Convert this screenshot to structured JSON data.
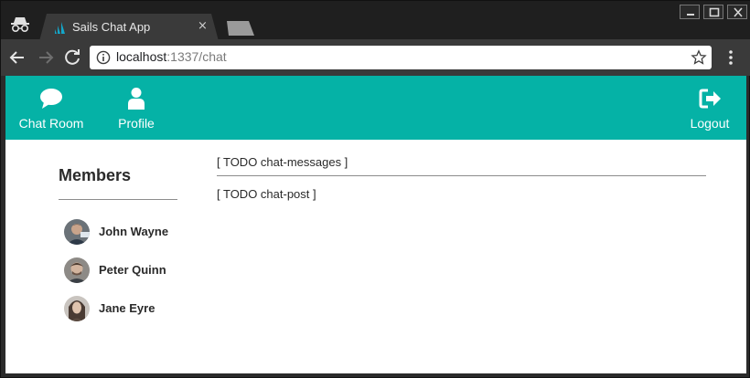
{
  "browser": {
    "tab": {
      "title": "Sails Chat App",
      "close": "×"
    },
    "address": {
      "host": "localhost",
      "path": ":1337/chat"
    }
  },
  "navbar": {
    "color": "#05b2a6",
    "items": [
      {
        "label": "Chat Room",
        "icon": "comment-icon"
      },
      {
        "label": "Profile",
        "icon": "user-icon"
      }
    ],
    "logout": {
      "label": "Logout",
      "icon": "sign-out-icon"
    }
  },
  "members": {
    "title": "Members",
    "list": [
      {
        "name": "John Wayne"
      },
      {
        "name": "Peter Quinn"
      },
      {
        "name": "Jane Eyre"
      }
    ]
  },
  "chat": {
    "messages_placeholder": "[ TODO chat-messages ]",
    "post_placeholder": "[ TODO chat-post ]"
  }
}
